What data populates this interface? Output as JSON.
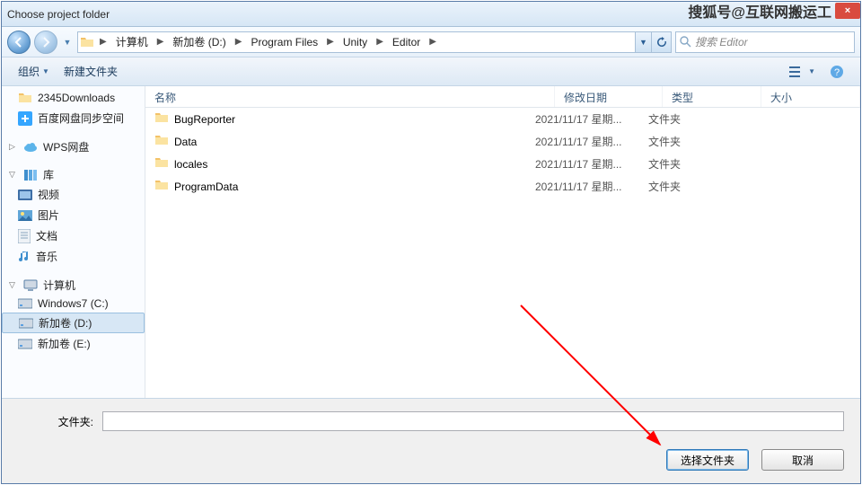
{
  "title": "Choose project folder",
  "watermark": {
    "text": "搜狐号@互联网搬运工",
    "close": "×"
  },
  "nav": {
    "back": "◀",
    "fwd": "▶",
    "crumbs": [
      "计算机",
      "新加卷 (D:)",
      "Program Files",
      "Unity",
      "Editor"
    ],
    "search_placeholder": "搜索 Editor"
  },
  "toolbar": {
    "organize": "组织",
    "newfolder": "新建文件夹"
  },
  "sidebar": {
    "quick": [
      {
        "name": "2345Downloads",
        "icon": "folder"
      },
      {
        "name": "百度网盘同步空间",
        "icon": "sync"
      }
    ],
    "wps": "WPS网盘",
    "lib_label": "库",
    "libs": [
      {
        "name": "视频",
        "icon": "video"
      },
      {
        "name": "图片",
        "icon": "picture"
      },
      {
        "name": "文档",
        "icon": "document"
      },
      {
        "name": "音乐",
        "icon": "music"
      }
    ],
    "computer_label": "计算机",
    "drives": [
      {
        "name": "Windows7 (C:)",
        "selected": false
      },
      {
        "name": "新加卷 (D:)",
        "selected": true
      },
      {
        "name": "新加卷 (E:)",
        "selected": false
      }
    ]
  },
  "columns": {
    "name": "名称",
    "date": "修改日期",
    "type": "类型",
    "size": "大小"
  },
  "rows": [
    {
      "name": "BugReporter",
      "date": "2021/11/17 星期...",
      "type": "文件夹",
      "size": ""
    },
    {
      "name": "Data",
      "date": "2021/11/17 星期...",
      "type": "文件夹",
      "size": ""
    },
    {
      "name": "locales",
      "date": "2021/11/17 星期...",
      "type": "文件夹",
      "size": ""
    },
    {
      "name": "ProgramData",
      "date": "2021/11/17 星期...",
      "type": "文件夹",
      "size": ""
    }
  ],
  "bottom": {
    "folder_label": "文件夹:",
    "folder_value": "",
    "select": "选择文件夹",
    "cancel": "取消"
  }
}
